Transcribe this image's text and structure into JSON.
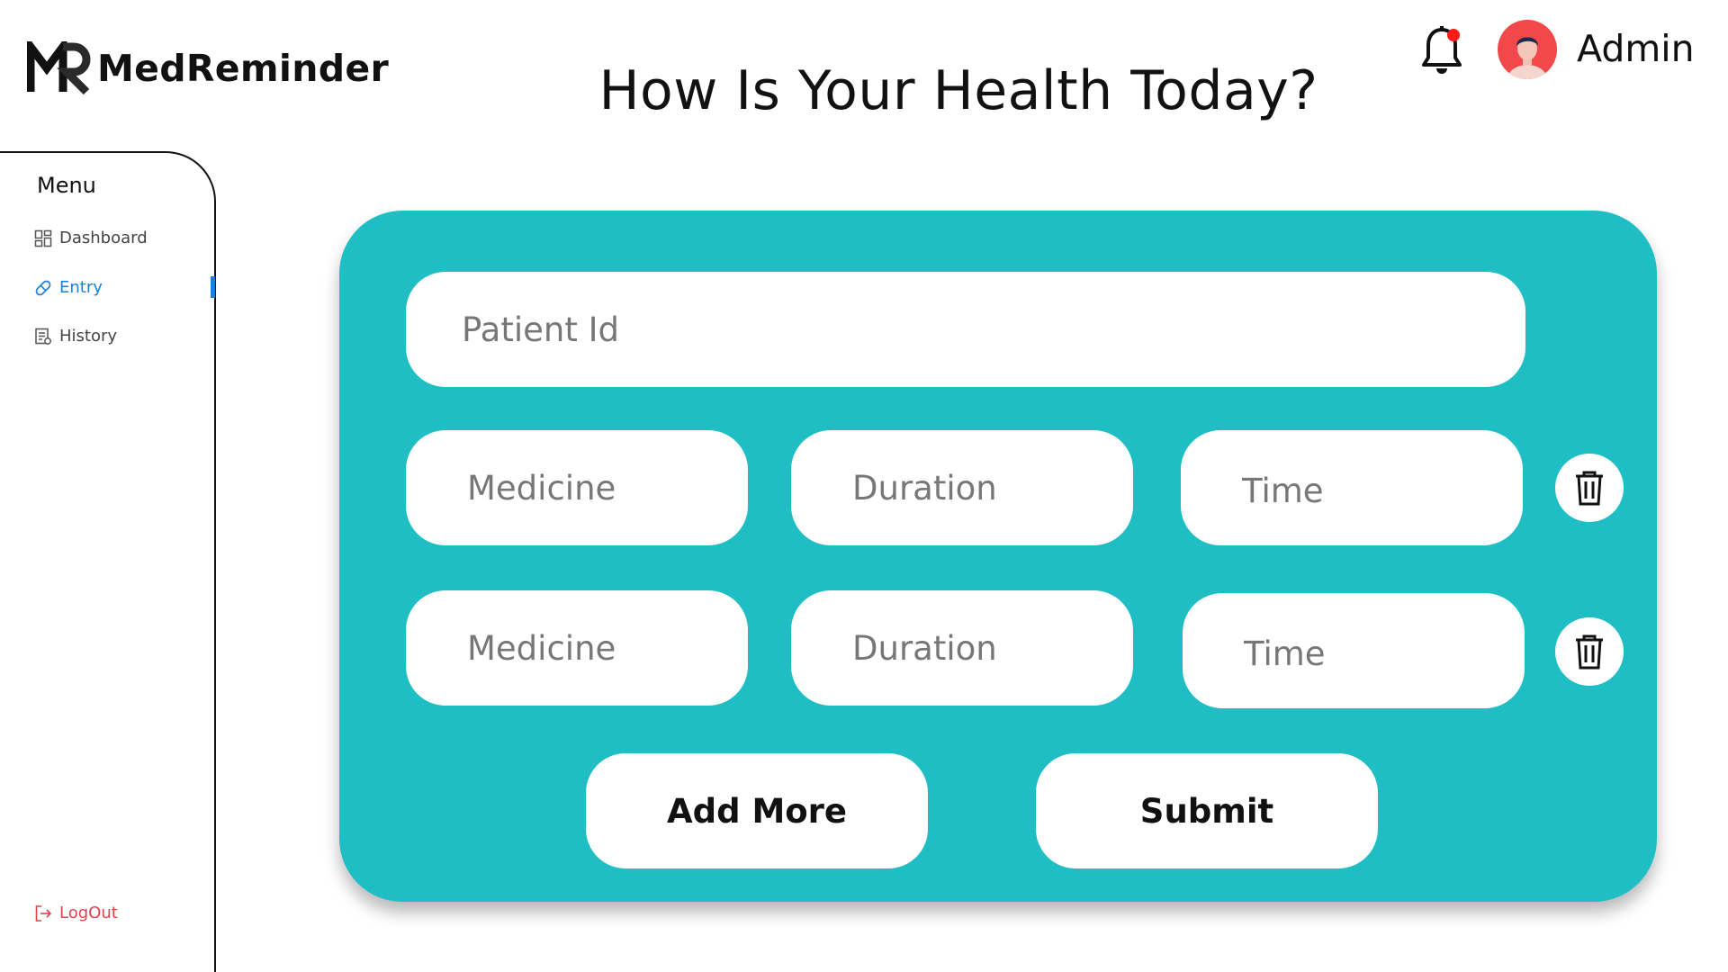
{
  "app": {
    "name": "MedReminder"
  },
  "header": {
    "title": "How Is Your Health Today?",
    "user_name": "Admin"
  },
  "sidebar": {
    "menu_title": "Menu",
    "items": [
      {
        "label": "Dashboard",
        "icon": "grid-icon",
        "active": false
      },
      {
        "label": "Entry",
        "icon": "pill-icon",
        "active": true
      },
      {
        "label": "History",
        "icon": "receipt-icon",
        "active": false
      }
    ],
    "logout_label": "LogOut"
  },
  "form": {
    "patient_id": {
      "value": "",
      "placeholder": "Patient Id"
    },
    "rows": [
      {
        "medicine": {
          "value": "",
          "placeholder": "Medicine"
        },
        "duration": {
          "value": "",
          "placeholder": "Duration"
        },
        "time": {
          "value": "",
          "placeholder": "Time"
        }
      },
      {
        "medicine": {
          "value": "",
          "placeholder": "Medicine"
        },
        "duration": {
          "value": "",
          "placeholder": "Duration"
        },
        "time": {
          "value": "",
          "placeholder": "Time"
        }
      }
    ],
    "add_more_label": "Add More",
    "submit_label": "Submit"
  },
  "colors": {
    "card": "#1fbec4",
    "active_nav": "#1e7fd8",
    "logout": "#e0414a",
    "notification_dot": "#ff1a1a",
    "avatar_bg": "#f2484b"
  },
  "notifications": {
    "has_unread": true
  }
}
